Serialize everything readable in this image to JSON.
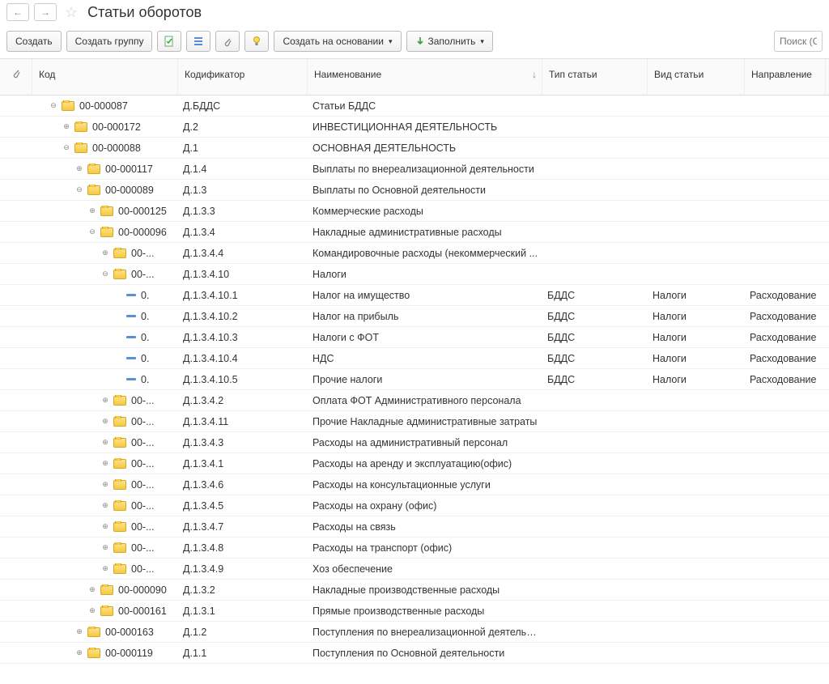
{
  "title": "Статьи оборотов",
  "toolbar": {
    "create": "Создать",
    "create_group": "Создать группу",
    "create_based": "Создать на основании",
    "fill": "Заполнить",
    "search_placeholder": "Поиск (Ctr"
  },
  "headers": {
    "code": "Код",
    "codifier": "Кодификатор",
    "name": "Наименование",
    "type": "Тип статьи",
    "kind": "Вид статьи",
    "direction": "Направление"
  },
  "rows": [
    {
      "indent": 0,
      "exp": "-",
      "icon": "folder",
      "code": "00-000087",
      "codifier": "Д.БДДС",
      "name": "Статьи БДДС",
      "type": "",
      "kind": "",
      "dir": ""
    },
    {
      "indent": 1,
      "exp": "+",
      "icon": "folder",
      "code": "00-000172",
      "codifier": "Д.2",
      "name": "ИНВЕСТИЦИОННАЯ ДЕЯТЕЛЬНОСТЬ",
      "type": "",
      "kind": "",
      "dir": ""
    },
    {
      "indent": 1,
      "exp": "-",
      "icon": "folder",
      "code": "00-000088",
      "codifier": "Д.1",
      "name": "ОСНОВНАЯ ДЕЯТЕЛЬНОСТЬ",
      "type": "",
      "kind": "",
      "dir": ""
    },
    {
      "indent": 2,
      "exp": "+",
      "icon": "folder",
      "code": "00-000117",
      "codifier": "Д.1.4",
      "name": "Выплаты по внереализационной деятельности",
      "type": "",
      "kind": "",
      "dir": ""
    },
    {
      "indent": 2,
      "exp": "-",
      "icon": "folder",
      "code": "00-000089",
      "codifier": "Д.1.3",
      "name": "Выплаты по Основной деятельности",
      "type": "",
      "kind": "",
      "dir": ""
    },
    {
      "indent": 3,
      "exp": "+",
      "icon": "folder",
      "code": "00-000125",
      "codifier": "Д.1.3.3",
      "name": "Коммерческие расходы",
      "type": "",
      "kind": "",
      "dir": ""
    },
    {
      "indent": 3,
      "exp": "-",
      "icon": "folder",
      "code": "00-000096",
      "codifier": "Д.1.3.4",
      "name": "Накладные административные расходы",
      "type": "",
      "kind": "",
      "dir": ""
    },
    {
      "indent": 4,
      "exp": "+",
      "icon": "folder",
      "code": "00-...",
      "codifier": "Д.1.3.4.4",
      "name": "Командировочные расходы (некоммерческий ...",
      "type": "",
      "kind": "",
      "dir": ""
    },
    {
      "indent": 4,
      "exp": "-",
      "icon": "folder",
      "code": "00-...",
      "codifier": "Д.1.3.4.10",
      "name": "Налоги",
      "type": "",
      "kind": "",
      "dir": ""
    },
    {
      "indent": 5,
      "exp": "",
      "icon": "leaf",
      "code": "0.",
      "codifier": "Д.1.3.4.10.1",
      "name": "Налог на имущество",
      "type": "БДДС",
      "kind": "Налоги",
      "dir": "Расходование"
    },
    {
      "indent": 5,
      "exp": "",
      "icon": "leaf",
      "code": "0.",
      "codifier": "Д.1.3.4.10.2",
      "name": "Налог на прибыль",
      "type": "БДДС",
      "kind": "Налоги",
      "dir": "Расходование"
    },
    {
      "indent": 5,
      "exp": "",
      "icon": "leaf",
      "code": "0.",
      "codifier": "Д.1.3.4.10.3",
      "name": "Налоги с ФОТ",
      "type": "БДДС",
      "kind": "Налоги",
      "dir": "Расходование"
    },
    {
      "indent": 5,
      "exp": "",
      "icon": "leaf",
      "code": "0.",
      "codifier": "Д.1.3.4.10.4",
      "name": "НДС",
      "type": "БДДС",
      "kind": "Налоги",
      "dir": "Расходование"
    },
    {
      "indent": 5,
      "exp": "",
      "icon": "leaf",
      "code": "0.",
      "codifier": "Д.1.3.4.10.5",
      "name": "Прочие налоги",
      "type": "БДДС",
      "kind": "Налоги",
      "dir": "Расходование"
    },
    {
      "indent": 4,
      "exp": "+",
      "icon": "folder",
      "code": "00-...",
      "codifier": "Д.1.3.4.2",
      "name": "Оплата ФОТ Административного персонала",
      "type": "",
      "kind": "",
      "dir": ""
    },
    {
      "indent": 4,
      "exp": "+",
      "icon": "folder",
      "code": "00-...",
      "codifier": "Д.1.3.4.11",
      "name": "Прочие Накладные административные затраты",
      "type": "",
      "kind": "",
      "dir": ""
    },
    {
      "indent": 4,
      "exp": "+",
      "icon": "folder",
      "code": "00-...",
      "codifier": "Д.1.3.4.3",
      "name": "Расходы на административный персонал",
      "type": "",
      "kind": "",
      "dir": ""
    },
    {
      "indent": 4,
      "exp": "+",
      "icon": "folder",
      "code": "00-...",
      "codifier": "Д.1.3.4.1",
      "name": "Расходы на аренду и эксплуатацию(офис)",
      "type": "",
      "kind": "",
      "dir": ""
    },
    {
      "indent": 4,
      "exp": "+",
      "icon": "folder",
      "code": "00-...",
      "codifier": "Д.1.3.4.6",
      "name": "Расходы на консультационные услуги",
      "type": "",
      "kind": "",
      "dir": ""
    },
    {
      "indent": 4,
      "exp": "+",
      "icon": "folder",
      "code": "00-...",
      "codifier": "Д.1.3.4.5",
      "name": "Расходы на охрану (офис)",
      "type": "",
      "kind": "",
      "dir": ""
    },
    {
      "indent": 4,
      "exp": "+",
      "icon": "folder",
      "code": "00-...",
      "codifier": "Д.1.3.4.7",
      "name": "Расходы на связь",
      "type": "",
      "kind": "",
      "dir": ""
    },
    {
      "indent": 4,
      "exp": "+",
      "icon": "folder",
      "code": "00-...",
      "codifier": "Д.1.3.4.8",
      "name": "Расходы на транспорт (офис)",
      "type": "",
      "kind": "",
      "dir": ""
    },
    {
      "indent": 4,
      "exp": "+",
      "icon": "folder",
      "code": "00-...",
      "codifier": "Д.1.3.4.9",
      "name": "Хоз обеспечение",
      "type": "",
      "kind": "",
      "dir": ""
    },
    {
      "indent": 3,
      "exp": "+",
      "icon": "folder",
      "code": "00-000090",
      "codifier": "Д.1.3.2",
      "name": "Накладные производственные расходы",
      "type": "",
      "kind": "",
      "dir": ""
    },
    {
      "indent": 3,
      "exp": "+",
      "icon": "folder",
      "code": "00-000161",
      "codifier": "Д.1.3.1",
      "name": "Прямые производственные расходы",
      "type": "",
      "kind": "",
      "dir": ""
    },
    {
      "indent": 2,
      "exp": "+",
      "icon": "folder",
      "code": "00-000163",
      "codifier": "Д.1.2",
      "name": "Поступления по внереализационной деятельн...",
      "type": "",
      "kind": "",
      "dir": ""
    },
    {
      "indent": 2,
      "exp": "+",
      "icon": "folder",
      "code": "00-000119",
      "codifier": "Д.1.1",
      "name": "Поступления по Основной деятельности",
      "type": "",
      "kind": "",
      "dir": ""
    }
  ]
}
